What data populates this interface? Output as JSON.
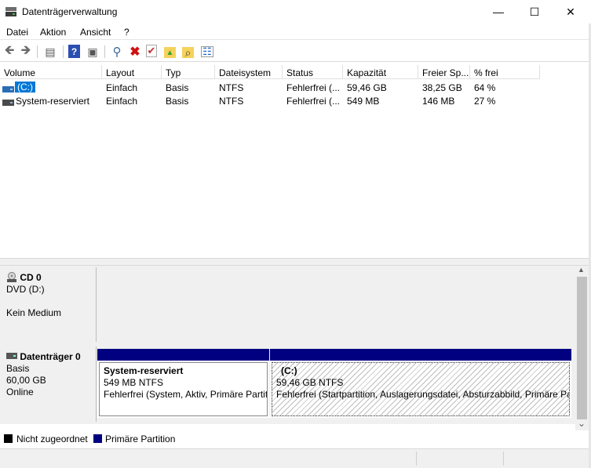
{
  "window": {
    "title": "Datenträgerverwaltung",
    "minimize": "—",
    "maximize": "☐",
    "close": "✕"
  },
  "menu": [
    "Datei",
    "Aktion",
    "Ansicht",
    "?"
  ],
  "toolbar": {
    "back": "🡸",
    "forward": "🡺",
    "console": "▤",
    "help": "?",
    "view": "▣",
    "connect": "⚲",
    "delete": "✖",
    "check": "✔",
    "folder": "▲",
    "explore": "⌕",
    "properties": "☷"
  },
  "columns": [
    "Volume",
    "Layout",
    "Typ",
    "Dateisystem",
    "Status",
    "Kapazität",
    "Freier Sp...",
    "% frei"
  ],
  "volumes": [
    {
      "name": "(C:)",
      "layout": "Einfach",
      "type": "Basis",
      "fs": "NTFS",
      "status": "Fehlerfrei (...",
      "capacity": "59,46 GB",
      "free": "38,25 GB",
      "pct": "64 %"
    },
    {
      "name": "System-reserviert",
      "layout": "Einfach",
      "type": "Basis",
      "fs": "NTFS",
      "status": "Fehlerfrei (...",
      "capacity": "549 MB",
      "free": "146 MB",
      "pct": "27 %"
    }
  ],
  "disks": {
    "cd": {
      "name": "CD 0",
      "drive": "DVD (D:)",
      "media": "Kein Medium"
    },
    "disk0": {
      "name": "Datenträger 0",
      "type": "Basis",
      "size": "60,00 GB",
      "state": "Online",
      "partitions": [
        {
          "title": "System-reserviert",
          "size": "549 MB NTFS",
          "status": "Fehlerfrei (System, Aktiv, Primäre Partit"
        },
        {
          "title": "(C:)",
          "size": "59,46 GB NTFS",
          "status": "Fehlerfrei (Startpartition, Auslagerungsdatei, Absturzabbild, Primäre Pa"
        }
      ]
    }
  },
  "legend": [
    {
      "label": "Nicht zugeordnet",
      "color": "#000000"
    },
    {
      "label": "Primäre Partition",
      "color": "#000080"
    }
  ],
  "scroll": {
    "up": "▲",
    "down": "⌄"
  }
}
